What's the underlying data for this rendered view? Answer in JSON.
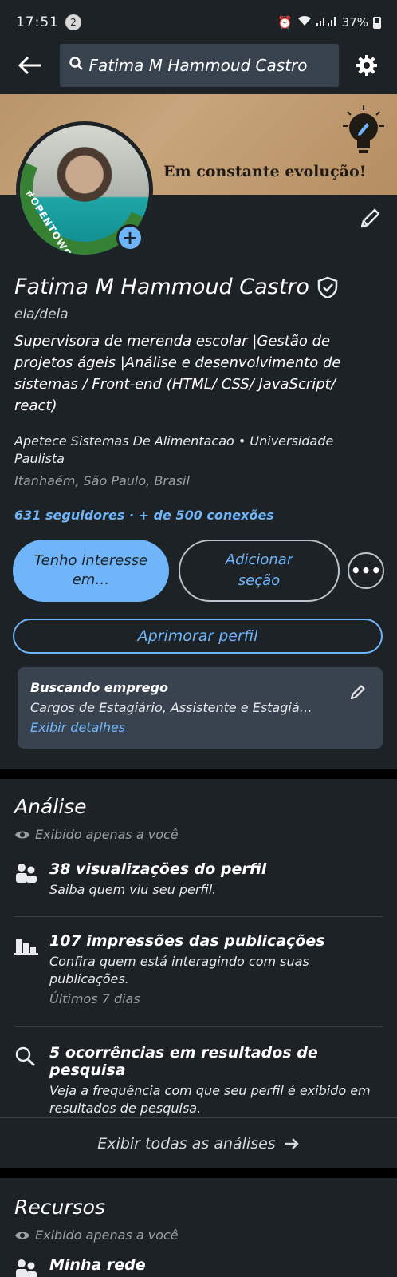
{
  "status_bar": {
    "time": "17:51",
    "notif_count": "2",
    "battery": "37%"
  },
  "search": {
    "query": "Fatima M Hammoud Castro"
  },
  "banner": {
    "text": "Em constante evolução!"
  },
  "avatar": {
    "frame_text": "#OPENTOWORK"
  },
  "profile": {
    "name": "Fatima M Hammoud Castro",
    "pronouns": "ela/dela",
    "headline": "Supervisora de merenda escolar |Gestão de projetos ágeis |Análise e desenvolvimento de sistemas / Front-end (HTML/ CSS/ JavaScript/ react)",
    "company": "Apetece Sistemas De Alimentacao • Universidade Paulista",
    "location": "Itanhaém, São Paulo, Brasil",
    "network": "631 seguidores · + de 500 conexões"
  },
  "actions": {
    "primary": "Tenho interesse em…",
    "add_section": "Adicionar seção",
    "more": "•••",
    "improve": "Aprimorar perfil"
  },
  "open_to_work": {
    "title": "Buscando emprego",
    "roles": "Cargos de Estagiário, Assistente e Estagiá…",
    "link": "Exibir detalhes"
  },
  "analytics": {
    "title": "Análise",
    "private_note": "Exibido apenas a você",
    "items": [
      {
        "title": "38 visualizações do perfil",
        "desc": "Saiba quem viu seu perfil.",
        "icon": "people-icon"
      },
      {
        "title": "107 impressões das publicações",
        "desc": "Confira quem está interagindo com suas publicações.",
        "meta": "Últimos 7 dias",
        "icon": "bar-chart-icon"
      },
      {
        "title": "5 ocorrências em resultados de pesquisa",
        "desc": "Veja a frequência com que seu perfil é exibido em resultados de pesquisa.",
        "icon": "search-icon"
      }
    ],
    "show_all": "Exibir todas as análises"
  },
  "resources": {
    "title": "Recursos",
    "private_note": "Exibido apenas a você",
    "first_item": "Minha rede"
  },
  "colors": {
    "accent": "#70b5f9",
    "surface": "#1d2226",
    "chip": "#38434f",
    "otw_green": "#378135"
  }
}
